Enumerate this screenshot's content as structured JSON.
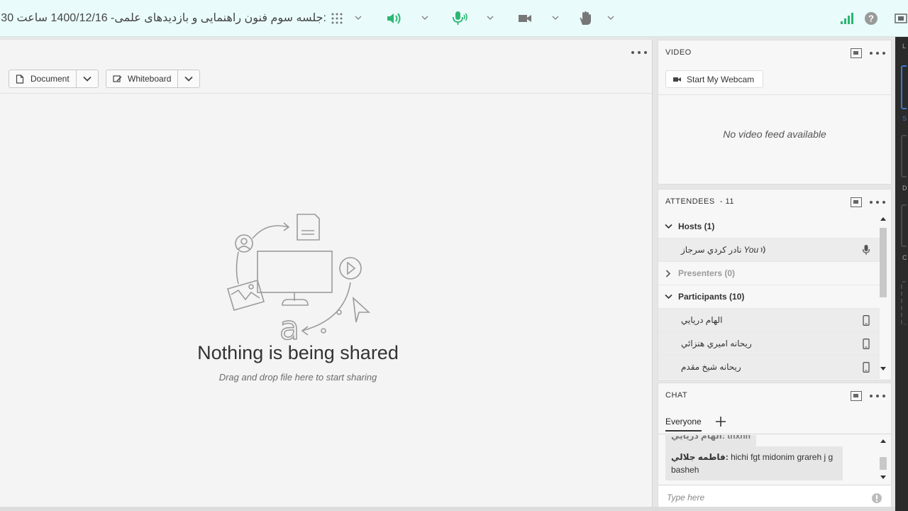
{
  "topbar": {
    "meeting_title": "جلسه سوم فنون راهنمایی و بازدیدهای علمی- 1400/12/16 ساعت 30:",
    "icons": [
      "grid-icon",
      "speaker-icon",
      "microphone-icon",
      "camera-icon",
      "raise-hand-icon",
      "connection-strength-icon",
      "help-icon",
      "fullscreen-icon"
    ],
    "accent_color": "#2bb673"
  },
  "share_pod": {
    "document_label": "Document",
    "whiteboard_label": "Whiteboard",
    "empty_title": "Nothing is being shared",
    "empty_subtitle": "Drag and drop file here to start sharing"
  },
  "video_pod": {
    "title": "VIDEO",
    "webcam_button": "Start My Webcam",
    "no_feed": "No video feed available"
  },
  "attendees_pod": {
    "title": "ATTENDEES",
    "count_label": "- 11",
    "hosts_label": "Hosts (1)",
    "host_name": "نادر كردي سرجاز",
    "host_you": "You",
    "presenters_label": "Presenters (0)",
    "participants_label": "Participants (10)",
    "participants": [
      "الهام دريايي",
      "ريحانه اميري هنزائي",
      "ريحانه شيخ مقدم"
    ]
  },
  "chat_pod": {
    "title": "CHAT",
    "tab_everyone": "Everyone",
    "partial_message": "الهام دريايي: tnxnn",
    "message_sender": "فاطمه جلالي:",
    "message_text": "hichi fgt midonim grareh j g basheh",
    "input_placeholder": "Type here"
  },
  "right_strip": {
    "letters": [
      "L",
      "S",
      "D",
      "C"
    ]
  }
}
